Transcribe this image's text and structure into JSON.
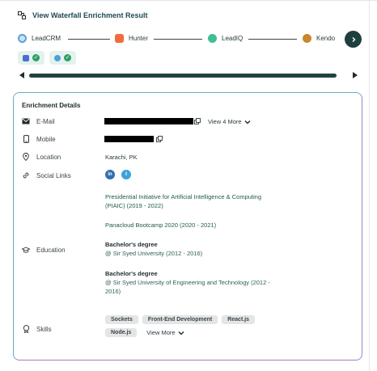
{
  "header": {
    "title": "View Waterfall Enrichment Result"
  },
  "providers": [
    {
      "name": "LeadCRM",
      "color": "#5aa1d8"
    },
    {
      "name": "Hunter",
      "color": "#f26b3a"
    },
    {
      "name": "LeadIQ",
      "color": "#3fbf8f"
    },
    {
      "name": "Kendo",
      "color": "#c9872b"
    }
  ],
  "card": {
    "title": "Enrichment Details",
    "email": {
      "label": "E-Mail",
      "view_more": "View 4 More"
    },
    "mobile": {
      "label": "Mobile"
    },
    "location": {
      "label": "Location",
      "value": "Karachi, PK"
    },
    "social": {
      "label": "Social Links",
      "links": [
        "linkedin",
        "twitter"
      ]
    },
    "education": {
      "label": "Education",
      "entries": [
        {
          "line1": "Presidential Initiative for Artificial Intelligence & Computing",
          "line2": "(PIAIC) (2019 - 2022)"
        },
        {
          "line1": "Panacloud Bootcamp 2020 (2020 - 2021)"
        },
        {
          "degree": "Bachelor's degree",
          "school": "@ Sir Syed University (2012 - 2016)"
        },
        {
          "degree": "Bachelor's degree",
          "school": "@ Sir Syed University of Engineering and Technology (2012 -",
          "school2": "2016)"
        }
      ]
    },
    "skills": {
      "label": "Skills",
      "tags": [
        "Sockets",
        "Front-End Development",
        "React.js",
        "Node.js"
      ],
      "view_more": "View More"
    }
  }
}
